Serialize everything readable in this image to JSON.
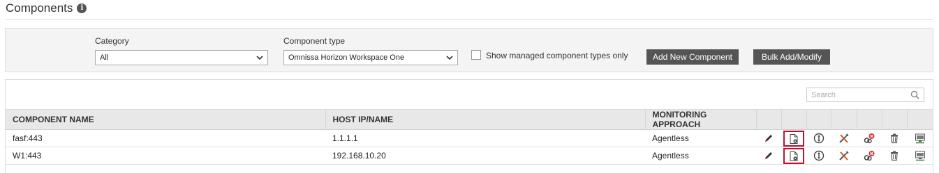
{
  "page": {
    "title": "Components"
  },
  "filters": {
    "category_label": "Category",
    "category_value": "All",
    "component_type_label": "Component type",
    "component_type_value": "Omnissa Horizon Workspace One",
    "managed_only_label": "Show managed component types only",
    "managed_only_checked": false,
    "add_button": "Add New Component",
    "bulk_button": "Bulk Add/Modify"
  },
  "search": {
    "placeholder": "Search"
  },
  "table": {
    "columns": [
      "COMPONENT NAME",
      "HOST IP/NAME",
      "MONITORING APPROACH"
    ],
    "rows": [
      {
        "name": "fasf:443",
        "host": "1.1.1.1",
        "approach": "Agentless"
      },
      {
        "name": "W1:443",
        "host": "192.168.10.20",
        "approach": "Agentless"
      }
    ],
    "row_actions": [
      "edit-icon",
      "config-icon",
      "drag-move-icon",
      "tools-icon",
      "unmanage-icon",
      "trash-icon",
      "ip-icon"
    ],
    "highlighted_action": "config-icon"
  },
  "colors": {
    "button_bg": "#555555",
    "header_bg": "#e8e8e8",
    "highlight_border": "#c0112f",
    "delete_accent": "#d9303a"
  }
}
